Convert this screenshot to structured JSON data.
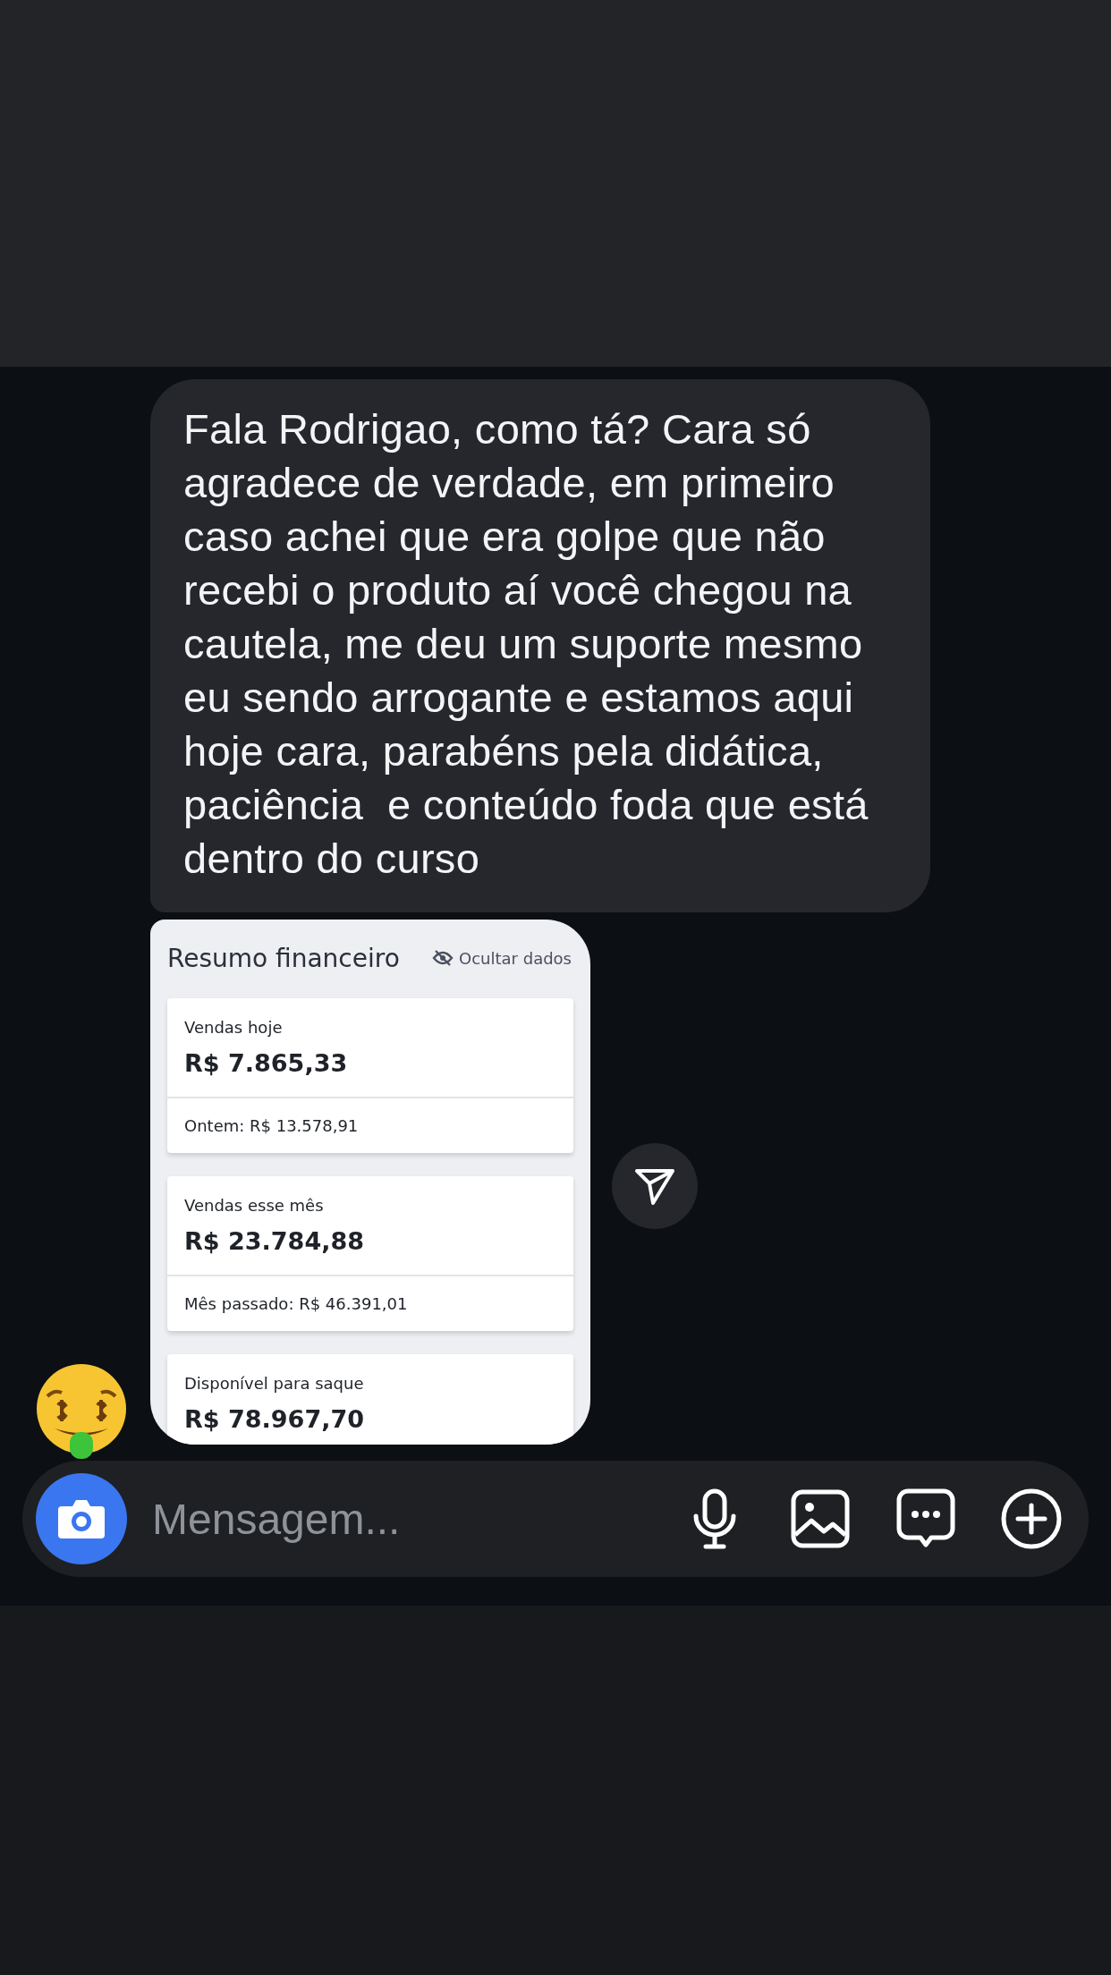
{
  "message": {
    "text": "Fala Rodrigao, como tá? Cara só agradece de verdade, em primeiro caso achei que era golpe que não recebi o produto aí você chegou na cautela, me deu um suporte mesmo eu sendo arrogante e estamos aqui hoje cara, parabéns pela didática, paciência  e conteúdo foda que está dentro do curso"
  },
  "shared_screenshot": {
    "title": "Resumo financeiro",
    "hide_link": "Ocultar dados",
    "cards": [
      {
        "label": "Vendas hoje",
        "value": "R$ 7.865,33",
        "footer": "Ontem: R$ 13.578,91"
      },
      {
        "label": "Vendas esse mês",
        "value": "R$ 23.784,88",
        "footer": "Mês passado: R$ 46.391,01"
      },
      {
        "label": "Disponível para saque",
        "value": "R$ 78.967,70"
      }
    ]
  },
  "composer": {
    "placeholder": "Mensagem..."
  }
}
